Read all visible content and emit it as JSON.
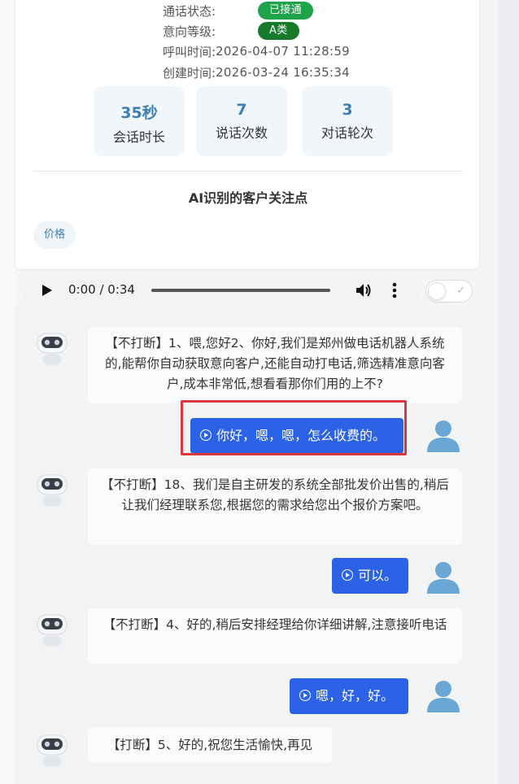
{
  "call_info": {
    "status_label": "通话状态:",
    "status_value": "已接通",
    "intent_label": "意向等级:",
    "intent_value": "A类",
    "call_time_label": "呼叫时间:",
    "call_time_value": "2026-04-07 11:28:59",
    "created_label": "创建时间:",
    "created_value": "2026-03-24 16:35:34"
  },
  "stats": [
    {
      "value": "35秒",
      "label": "会话时长"
    },
    {
      "value": "7",
      "label": "说话次数"
    },
    {
      "value": "3",
      "label": "对话轮次"
    }
  ],
  "focus": {
    "title": "AI识别的客户关注点",
    "tags": [
      "价格"
    ]
  },
  "player": {
    "time": "0:00 / 0:34"
  },
  "colors": {
    "accent_blue": "#2c63e6",
    "status_green": "#1fa34a",
    "intent_green": "#167a2a",
    "highlight_red": "#d9363e"
  },
  "messages": [
    {
      "role": "bot",
      "text": "【不打断】1、喂,您好2、你好,我们是郑州做电话机器人系统的,能帮你自动获取意向客户,还能自动打电话,筛选精准意向客户,成本非常低,想看看那你们用的上不?"
    },
    {
      "role": "user",
      "text": "你好，嗯，嗯，怎么收费的。"
    },
    {
      "role": "bot",
      "text": "【不打断】18、我们是自主研发的系统全部批发价出售的,稍后让我们经理联系您,根据您的需求给您出个报价方案吧。"
    },
    {
      "role": "user",
      "text": "可以。"
    },
    {
      "role": "bot",
      "text": "【不打断】4、好的,稍后安排经理给你详细讲解,注意接听电话"
    },
    {
      "role": "user",
      "text": "嗯，好，好。"
    },
    {
      "role": "bot",
      "text": "【打断】5、好的,祝您生活愉快,再见"
    }
  ]
}
